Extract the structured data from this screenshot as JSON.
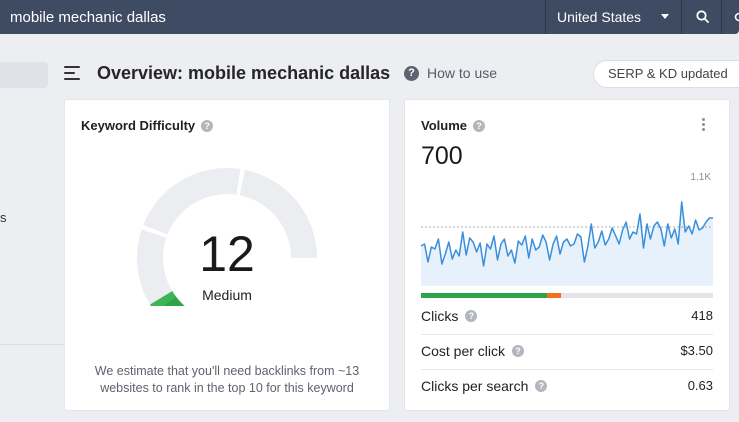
{
  "search": {
    "query": "mobile mechanic dallas",
    "country": "United States"
  },
  "sidebar": {
    "partial_text": "s"
  },
  "header": {
    "title": "Overview: mobile mechanic dallas",
    "help_label": "How to use",
    "serp_badge": "SERP & KD updated"
  },
  "keyword_difficulty": {
    "title": "Keyword Difficulty",
    "value": "12",
    "level": "Medium",
    "score": 12,
    "description": "We estimate that you'll need backlinks from ~13 websites to rank in the top 10 for this keyword"
  },
  "volume": {
    "title": "Volume",
    "value": "700",
    "chart_max_label": "1.1K",
    "clicks_distribution": {
      "organic_fraction": 0.43,
      "paid_fraction": 0.05
    },
    "metrics": [
      {
        "label": "Clicks",
        "value": "418"
      },
      {
        "label": "Cost per click",
        "value": "$3.50"
      },
      {
        "label": "Clicks per search",
        "value": "0.63"
      }
    ]
  },
  "colors": {
    "topbar": "#3f4b63",
    "gauge_green": "#2fa24a",
    "volume_line": "#3a8fdb",
    "clicks_organic": "#2fa24a",
    "clicks_paid": "#f2711c"
  },
  "icons": {
    "search": "search-icon",
    "menu": "menu-icon",
    "help": "help-icon",
    "more": "kebab-icon"
  }
}
